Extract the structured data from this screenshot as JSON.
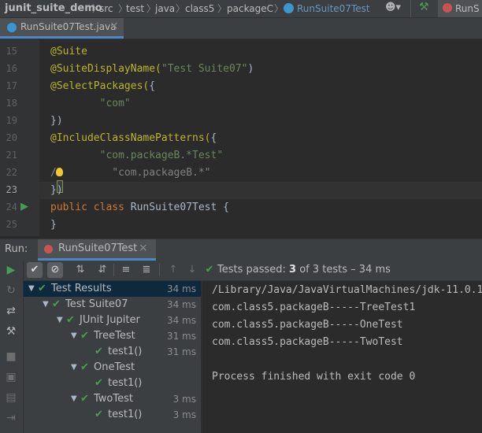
{
  "navbar": {
    "project": "junit_suite_demo",
    "crumbs": [
      "src",
      "test",
      "java",
      "class5",
      "packageC",
      "RunSuite07Test"
    ],
    "run_config": "RunS"
  },
  "tabs": [
    {
      "label": "RunSuite07Test.java",
      "close": "×"
    }
  ],
  "editor": {
    "lines": [
      {
        "n": "15",
        "parts": [
          {
            "t": "@Suite",
            "c": "ann"
          }
        ]
      },
      {
        "n": "16",
        "parts": [
          {
            "t": "@SuiteDisplayName(",
            "c": "ann"
          },
          {
            "t": "\"Test Suite07\"",
            "c": "str"
          },
          {
            "t": ")",
            "c": "txt"
          }
        ]
      },
      {
        "n": "17",
        "parts": [
          {
            "t": "@SelectPackages(",
            "c": "ann"
          },
          {
            "t": "{",
            "c": "txt"
          }
        ]
      },
      {
        "n": "18",
        "parts": [
          {
            "t": "        \"com\"",
            "c": "str"
          }
        ]
      },
      {
        "n": "19",
        "parts": [
          {
            "t": "})",
            "c": "txt"
          }
        ]
      },
      {
        "n": "20",
        "parts": [
          {
            "t": "@IncludeClassNamePatterns(",
            "c": "ann"
          },
          {
            "t": "{",
            "c": "txt"
          }
        ]
      },
      {
        "n": "21",
        "parts": [
          {
            "t": "        \"com.packageB.*Test\"",
            "c": "str"
          }
        ]
      },
      {
        "n": "22",
        "parts": [
          {
            "t": "/",
            "c": "cmt"
          },
          {
            "t": "         \"com.packageB.*\"",
            "c": "cmt"
          }
        ]
      },
      {
        "n": "23",
        "parts": [
          {
            "t": "})",
            "c": "txt"
          }
        ]
      },
      {
        "n": "24",
        "parts": [
          {
            "t": "public class ",
            "c": "kw"
          },
          {
            "t": "RunSuite07Test {",
            "c": "txt"
          }
        ]
      },
      {
        "n": "25",
        "parts": [
          {
            "t": "}",
            "c": "txt"
          }
        ]
      }
    ]
  },
  "run": {
    "label": "Run:",
    "tab": "RunSuite07Test",
    "close": "×",
    "status_prefix": "Tests passed: ",
    "passed": "3",
    "status_suffix": " of 3 tests – 34 ms"
  },
  "tree": [
    {
      "label": "Test Results",
      "time": "34 ms",
      "depth": 0,
      "chevron": true
    },
    {
      "label": "Test Suite07",
      "time": "34 ms",
      "depth": 1,
      "chevron": true
    },
    {
      "label": "JUnit Jupiter",
      "time": "34 ms",
      "depth": 2,
      "chevron": true
    },
    {
      "label": "TreeTest",
      "time": "31 ms",
      "depth": 3,
      "chevron": true
    },
    {
      "label": "test1()",
      "time": "31 ms",
      "depth": 4,
      "chevron": false
    },
    {
      "label": "OneTest",
      "time": "",
      "depth": 3,
      "chevron": true
    },
    {
      "label": "test1()",
      "time": "",
      "depth": 4,
      "chevron": false
    },
    {
      "label": "TwoTest",
      "time": "3 ms",
      "depth": 3,
      "chevron": true
    },
    {
      "label": "test1()",
      "time": "3 ms",
      "depth": 4,
      "chevron": false
    }
  ],
  "console": [
    "/Library/Java/JavaVirtualMachines/jdk-11.0.1",
    "com.class5.packageB-----TreeTest1",
    "com.class5.packageB-----OneTest",
    "com.class5.packageB-----TwoTest",
    "",
    "Process finished with exit code 0"
  ],
  "colors": {
    "accent": "#4a88c7",
    "pass": "#499c54",
    "annotation": "#bbb529",
    "string": "#6a8759",
    "keyword": "#cc7832"
  }
}
